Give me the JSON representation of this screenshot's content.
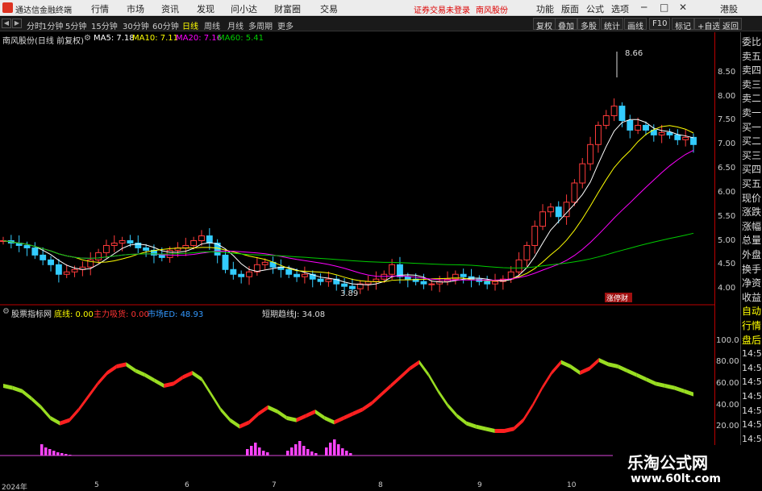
{
  "app": {
    "name": "通达信金融终端"
  },
  "menu": [
    "行情",
    "市场",
    "资讯",
    "发现",
    "问小达",
    "财富圈",
    "交易"
  ],
  "title_notice": "证券交易未登录",
  "stock_name_title": "南风股份",
  "top_right": [
    "功能",
    "版面",
    "公式",
    "选项"
  ],
  "top_right_extra": "港股",
  "periods": [
    "分时",
    "1分钟",
    "5分钟",
    "15分钟",
    "30分钟",
    "60分钟",
    "日线",
    "周线",
    "月线",
    "多周期",
    "更多"
  ],
  "active_period": "日线",
  "toolbar_right": [
    "复权",
    "叠加",
    "多股",
    "统计",
    "画线",
    "F10",
    "标记",
    "+自选",
    "返回"
  ],
  "info": {
    "title": "南风股份(日线 前复权)",
    "ma5": "MA5: 7.18",
    "ma10": "MA10: 7.11",
    "ma20": "MA20: 7.16",
    "ma60": "MA60: 5.41"
  },
  "price_axis": [
    "8.50",
    "8.00",
    "7.50",
    "7.00",
    "6.50",
    "6.00",
    "5.50",
    "5.00",
    "4.50",
    "4.00"
  ],
  "ind_axis": [
    "100.0",
    "80.00",
    "60.00",
    "40.00",
    "20.00"
  ],
  "annotations": {
    "high": "8.66",
    "low": "3.89",
    "tag": "涨停财"
  },
  "indicator": {
    "name": "股票指标网",
    "bottom": "底线: 0.00",
    "main": "主力吸货: 0.00",
    "market": "市场ED: 48.93",
    "short": "短期趋线J: 34.08"
  },
  "right_panel": [
    "委比",
    "卖五",
    "卖四",
    "卖三",
    "卖二",
    "卖一",
    "买一",
    "买二",
    "买三",
    "买四",
    "买五",
    "现价",
    "涨跌",
    "涨幅",
    "总量",
    "外盘",
    "换手",
    "净资",
    "收益",
    "自动",
    "行情",
    "盘后",
    "14:50",
    "14:50",
    "14:50",
    "14:50",
    "14:50",
    "14:50",
    "14:50"
  ],
  "dates": [
    "2024年",
    "5",
    "6",
    "7",
    "8",
    "9",
    "10"
  ],
  "watermark": {
    "line1": "乐淘公式网",
    "line2": "www.60lt.com"
  },
  "colors": {
    "up": "#ff3b3b",
    "down": "#33ccff",
    "ma5": "#ffffff",
    "ma10": "#ffff00",
    "ma20": "#ff00ff",
    "ma60": "#00cc00",
    "ind_up": "#ff2020",
    "ind_down": "#99dd22",
    "bars": "#ff44ff"
  },
  "chart_data": {
    "type": "candlestick",
    "ylim": [
      3.7,
      8.8
    ],
    "ind_ylim": [
      0,
      120
    ],
    "close": [
      5.0,
      4.95,
      4.9,
      4.85,
      4.7,
      4.6,
      4.5,
      4.3,
      4.35,
      4.4,
      4.45,
      4.6,
      4.75,
      4.9,
      4.95,
      5.0,
      4.95,
      4.85,
      4.8,
      4.7,
      4.65,
      4.8,
      4.85,
      4.9,
      5.0,
      5.1,
      4.95,
      4.7,
      4.4,
      4.3,
      4.25,
      4.35,
      4.5,
      4.55,
      4.45,
      4.4,
      4.3,
      4.25,
      4.3,
      4.2,
      4.15,
      4.2,
      4.1,
      4.05,
      4.0,
      4.1,
      4.15,
      4.2,
      4.3,
      4.5,
      4.25,
      4.2,
      4.15,
      4.1,
      4.1,
      4.15,
      4.2,
      4.3,
      4.25,
      4.2,
      4.15,
      4.1,
      4.15,
      4.2,
      4.35,
      4.6,
      4.9,
      5.3,
      5.6,
      5.7,
      5.5,
      5.8,
      6.2,
      6.6,
      7.0,
      7.4,
      7.6,
      7.8,
      7.5,
      7.3,
      7.4,
      7.3,
      7.2,
      7.25,
      7.2,
      7.1,
      7.15,
      7.0
    ],
    "ind_values": [
      60,
      58,
      55,
      48,
      40,
      30,
      25,
      28,
      38,
      50,
      62,
      72,
      78,
      80,
      74,
      70,
      65,
      60,
      62,
      68,
      72,
      66,
      52,
      38,
      28,
      22,
      26,
      34,
      40,
      36,
      30,
      28,
      32,
      36,
      30,
      26,
      30,
      34,
      38,
      44,
      52,
      60,
      68,
      76,
      82,
      70,
      55,
      42,
      32,
      25,
      22,
      20,
      18,
      18,
      20,
      28,
      42,
      58,
      72,
      82,
      78,
      72,
      76,
      84,
      80,
      78,
      74,
      70,
      66,
      62,
      60,
      58,
      55,
      52
    ]
  }
}
